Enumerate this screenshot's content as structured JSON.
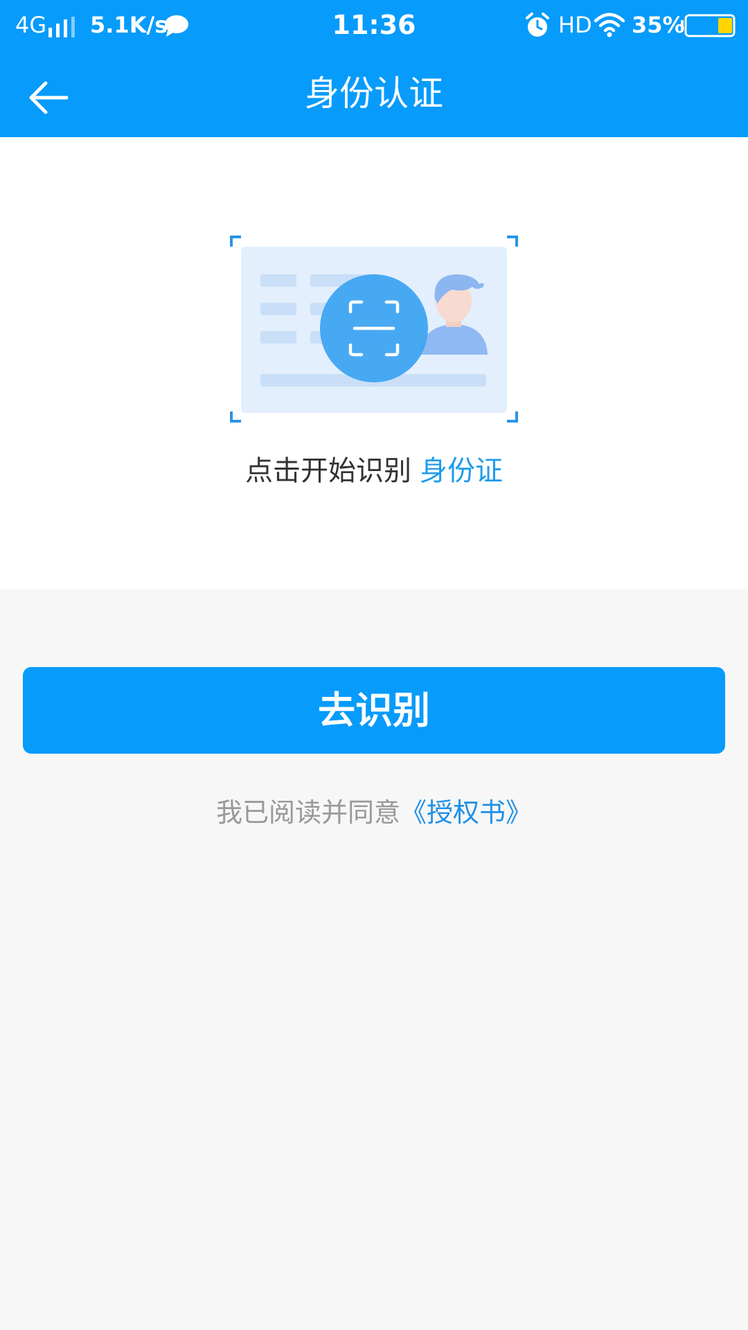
{
  "status_bar": {
    "network": "4G",
    "speed": "5.1K/s",
    "time": "11:36",
    "hd": "HD",
    "battery": "35%"
  },
  "header": {
    "title": "身份认证"
  },
  "scan": {
    "hint_prefix": "点击开始识别",
    "hint_accent": "身份证"
  },
  "actions": {
    "recognize_label": "去识别"
  },
  "agreement": {
    "text": "我已阅读并同意",
    "link_label": "《授权书》"
  },
  "icons": {
    "back": "back-arrow-icon",
    "scan": "scan-icon",
    "chat": "chat-bubble-icon",
    "alarm": "alarm-icon",
    "wifi": "wifi-icon",
    "battery": "battery-icon",
    "signal": "signal-icon"
  },
  "colors": {
    "brand": "#079bfb",
    "accent_text": "#1e9bea",
    "background": "#f7f7f7"
  }
}
